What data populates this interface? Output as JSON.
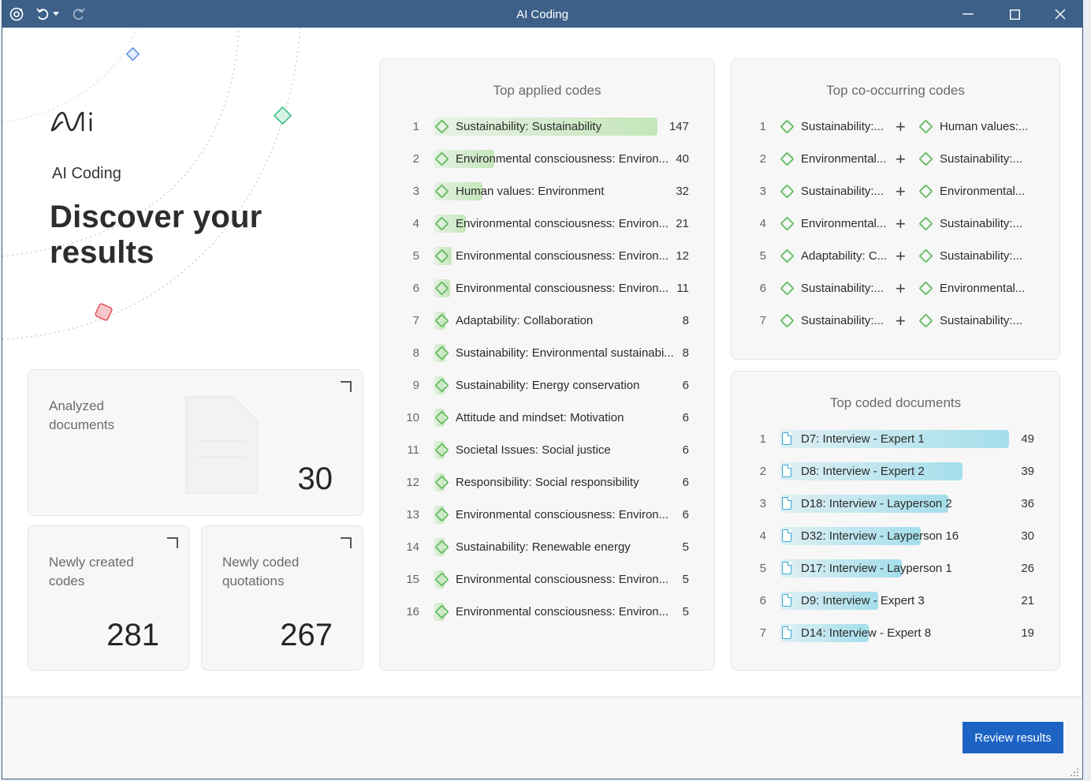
{
  "window": {
    "title": "AI Coding"
  },
  "hero": {
    "app_name": "AI Coding",
    "heading": "Discover your results"
  },
  "stats": {
    "analyzed": {
      "label": "Analyzed documents",
      "value": "30"
    },
    "codes": {
      "label": "Newly created codes",
      "value": "281"
    },
    "quotations": {
      "label": "Newly coded quotations",
      "value": "267"
    }
  },
  "top_applied": {
    "title": "Top applied codes",
    "max": 147,
    "rows": [
      {
        "rank": "1",
        "label": "Sustainability: Sustainability",
        "count": 147
      },
      {
        "rank": "2",
        "label": "Environmental consciousness: Environ...",
        "count": 40
      },
      {
        "rank": "3",
        "label": "Human values: Environment",
        "count": 32
      },
      {
        "rank": "4",
        "label": "Environmental consciousness: Environ...",
        "count": 21
      },
      {
        "rank": "5",
        "label": "Environmental consciousness: Environ...",
        "count": 12
      },
      {
        "rank": "6",
        "label": "Environmental consciousness: Environ...",
        "count": 11
      },
      {
        "rank": "7",
        "label": "Adaptability: Collaboration",
        "count": 8
      },
      {
        "rank": "8",
        "label": "Sustainability: Environmental sustainabi...",
        "count": 8
      },
      {
        "rank": "9",
        "label": "Sustainability: Energy conservation",
        "count": 6
      },
      {
        "rank": "10",
        "label": "Attitude and mindset: Motivation",
        "count": 6
      },
      {
        "rank": "11",
        "label": "Societal Issues: Social justice",
        "count": 6
      },
      {
        "rank": "12",
        "label": "Responsibility: Social responsibility",
        "count": 6
      },
      {
        "rank": "13",
        "label": "Environmental consciousness: Environ...",
        "count": 6
      },
      {
        "rank": "14",
        "label": "Sustainability: Renewable energy",
        "count": 5
      },
      {
        "rank": "15",
        "label": "Environmental consciousness: Environ...",
        "count": 5
      },
      {
        "rank": "16",
        "label": "Environmental consciousness: Environ...",
        "count": 5
      }
    ]
  },
  "top_cooccurring": {
    "title": "Top co-occurring codes",
    "rows": [
      {
        "rank": "1",
        "a": "Sustainability:...",
        "b": "Human values:..."
      },
      {
        "rank": "2",
        "a": "Environmental...",
        "b": "Sustainability:..."
      },
      {
        "rank": "3",
        "a": "Sustainability:...",
        "b": "Environmental..."
      },
      {
        "rank": "4",
        "a": "Environmental...",
        "b": "Sustainability:..."
      },
      {
        "rank": "5",
        "a": "Adaptability: C...",
        "b": "Sustainability:..."
      },
      {
        "rank": "6",
        "a": "Sustainability:...",
        "b": "Environmental..."
      },
      {
        "rank": "7",
        "a": "Sustainability:...",
        "b": "Sustainability:..."
      }
    ]
  },
  "top_documents": {
    "title": "Top coded documents",
    "max": 49,
    "rows": [
      {
        "rank": "1",
        "label": "D7: Interview - Expert 1",
        "count": 49
      },
      {
        "rank": "2",
        "label": "D8: Interview - Expert 2",
        "count": 39
      },
      {
        "rank": "3",
        "label": "D18: Interview - Layperson 2",
        "count": 36
      },
      {
        "rank": "4",
        "label": "D32: Interview - Layperson 16",
        "count": 30
      },
      {
        "rank": "5",
        "label": "D17: Interview - Layperson 1",
        "count": 26
      },
      {
        "rank": "6",
        "label": "D9: Interview - Expert 3",
        "count": 21
      },
      {
        "rank": "7",
        "label": "D14: Interview - Expert 8",
        "count": 19
      }
    ]
  },
  "footer": {
    "review_label": "Review results"
  },
  "colors": {
    "titlebar": "#3d6088",
    "accent": "#1d63c4",
    "green_bar": "#c4e6ba",
    "blue_bar": "#a4deeb"
  }
}
